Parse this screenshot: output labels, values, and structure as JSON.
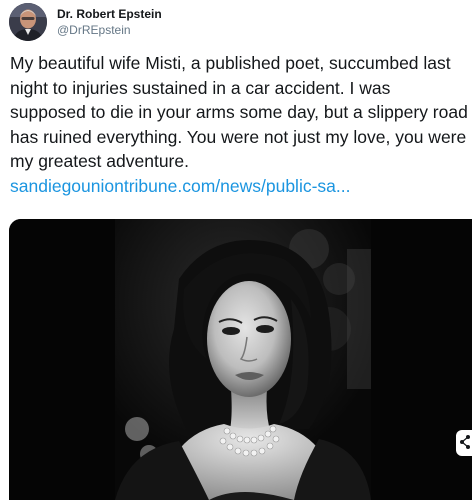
{
  "author": {
    "name": "Dr. Robert Epstein",
    "handle": "@DrREpstein",
    "avatar_icon": "profile-avatar"
  },
  "tweet": {
    "text": "My beautiful wife Misti, a published poet, succumbed last night to injuries sustained in a car accident. I was supposed to die in your arms some day, but a slippery road has ruined everything. You were not just my love, you were my greatest adventure.",
    "link": "sandiegouniontribune.com/news/public-sa..."
  },
  "media": {
    "type": "black-and-white-portrait-photo",
    "share_icon": "share-icon"
  },
  "colors": {
    "link": "#1b95e0",
    "handle": "#657786",
    "text": "#14171a",
    "media_bg": "#050505"
  }
}
